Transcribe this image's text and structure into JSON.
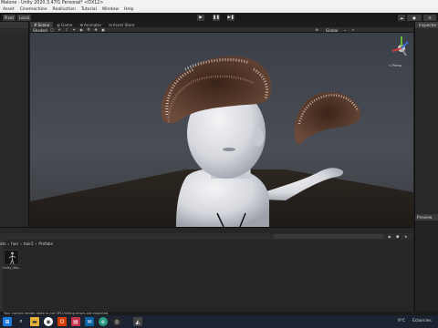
{
  "window": {
    "title": "Malone - Unity 2020.3.47f1 Personal* <DX12>"
  },
  "menu": [
    "Asset",
    "Cinemachine",
    "Realluction",
    "Tutorial",
    "Window",
    "Help"
  ],
  "toolbar": {
    "pivot_label": "Pivot",
    "local_label": "Local",
    "play_icon": "play-icon",
    "pause_icon": "pause-icon",
    "step_icon": "step-icon"
  },
  "scene_tabs": [
    {
      "label": "Scene",
      "active": true
    },
    {
      "label": "Game",
      "active": false
    },
    {
      "label": "Animator",
      "active": false
    },
    {
      "label": "Asset Store",
      "active": false
    }
  ],
  "scene_toolbar": {
    "shading_label": "Shaded",
    "coords_label": "Global"
  },
  "gizmo": {
    "label": "< Persp"
  },
  "inspector": {
    "tab_label": "Inspector"
  },
  "preview": {
    "tab_label": "Preview"
  },
  "project": {
    "breadcrumb": [
      "ets",
      "hair",
      "hair2",
      "Prefabs"
    ],
    "asset_label": "Unity_Wo..."
  },
  "status": {
    "message": "Your current render state is not GPU-hitting errors are expected."
  },
  "taskbar": {
    "temperature": "9°C",
    "weather": "Eclaircies",
    "apps": [
      "windows-icon",
      "search-icon",
      "explorer-icon",
      "chrome-icon",
      "office-icon",
      "store-icon",
      "mail-icon",
      "edge-icon",
      "unity-icon",
      "terminal-icon"
    ]
  },
  "colors": {
    "accent": "#2f6fd6",
    "background": "#1e1e1e",
    "sky": "#3a3f49",
    "ground": "#2a241f"
  }
}
